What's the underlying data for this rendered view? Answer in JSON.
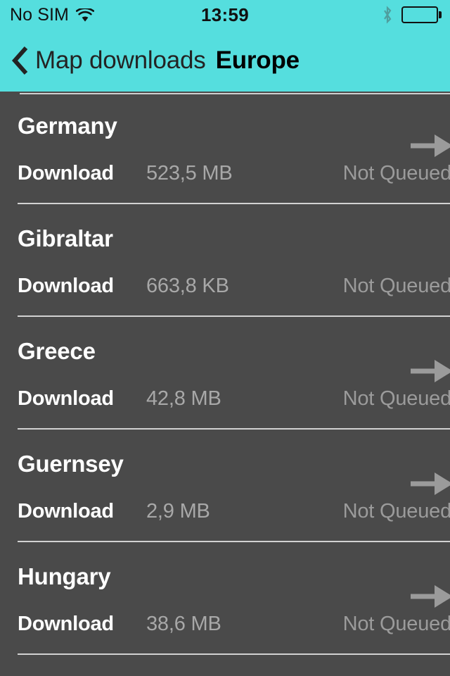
{
  "status_bar": {
    "carrier": "No SIM",
    "wifi_icon": "wifi-icon",
    "time": "13:59",
    "bluetooth_icon": "bluetooth-icon",
    "battery_icon": "battery-full-icon"
  },
  "nav": {
    "back_icon": "chevron-left-icon",
    "back_label": "Map downloads",
    "title": "Europe"
  },
  "colors": {
    "header_teal": "#55dede",
    "body_background": "#4a4a4a",
    "primary_text": "#ffffff",
    "secondary_text": "#a8a8a8",
    "status_text": "#9b9b9b",
    "separator": "#d2d2d2",
    "arrow": "#9b9b9b"
  },
  "list": {
    "rows": [
      {
        "name": "Germany",
        "action_label": "Download",
        "size": "523,5 MB",
        "status": "Not Queued",
        "has_arrow": true,
        "arrow_icon": "arrow-right-icon"
      },
      {
        "name": "Gibraltar",
        "action_label": "Download",
        "size": "663,8 KB",
        "status": "Not Queued",
        "has_arrow": false,
        "arrow_icon": ""
      },
      {
        "name": "Greece",
        "action_label": "Download",
        "size": "42,8 MB",
        "status": "Not Queued",
        "has_arrow": true,
        "arrow_icon": "arrow-right-icon"
      },
      {
        "name": "Guernsey",
        "action_label": "Download",
        "size": "2,9 MB",
        "status": "Not Queued",
        "has_arrow": true,
        "arrow_icon": "arrow-right-icon"
      },
      {
        "name": "Hungary",
        "action_label": "Download",
        "size": "38,6 MB",
        "status": "Not Queued",
        "has_arrow": true,
        "arrow_icon": "arrow-right-icon"
      }
    ]
  }
}
